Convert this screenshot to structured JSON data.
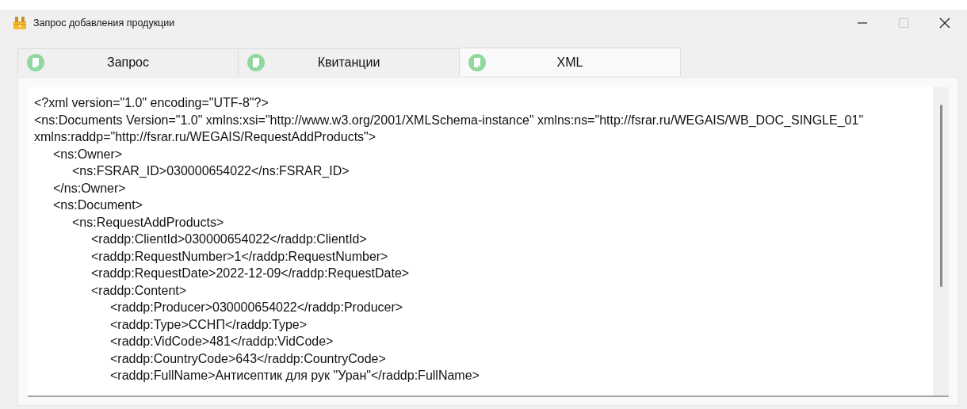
{
  "window": {
    "title": "Запрос добавления продукции",
    "maximize_disabled": true
  },
  "tabs": [
    {
      "label": "Запрос",
      "selected": false
    },
    {
      "label": "Квитанции",
      "selected": false
    },
    {
      "label": "XML",
      "selected": true
    }
  ],
  "xml": [
    {
      "text": "<?xml version=\"1.0\" encoding=\"UTF-8\"?>"
    },
    {
      "text": "<ns:Documents Version=\"1.0\" xmlns:xsi=\"http://www.w3.org/2001/XMLSchema-instance\" xmlns:ns=\"http://fsrar.ru/WEGAIS/WB_DOC_SINGLE_01\" xmlns:raddp=\"http://fsrar.ru/WEGAIS/RequestAddProducts\">",
      "children": [
        {
          "text": "<ns:Owner>",
          "children": [
            {
              "text": "<ns:FSRAR_ID>030000654022</ns:FSRAR_ID>"
            }
          ]
        },
        {
          "text": "</ns:Owner>"
        },
        {
          "text": "<ns:Document>",
          "children": [
            {
              "text": "<ns:RequestAddProducts>",
              "children": [
                {
                  "text": "<raddp:ClientId>030000654022</raddp:ClientId>"
                },
                {
                  "text": "<raddp:RequestNumber>1</raddp:RequestNumber>"
                },
                {
                  "text": "<raddp:RequestDate>2022-12-09</raddp:RequestDate>"
                },
                {
                  "text": "<raddp:Content>",
                  "children": [
                    {
                      "text": "<raddp:Producer>030000654022</raddp:Producer>"
                    },
                    {
                      "text": "<raddp:Type>ССНП</raddp:Type>"
                    },
                    {
                      "text": "<raddp:VidCode>481</raddp:VidCode>"
                    },
                    {
                      "text": "<raddp:CountryCode>643</raddp:CountryCode>"
                    },
                    {
                      "text": "<raddp:FullName>Антисептик для рук \"Уран\"</raddp:FullName>"
                    }
                  ]
                }
              ]
            }
          ]
        }
      ]
    }
  ]
}
